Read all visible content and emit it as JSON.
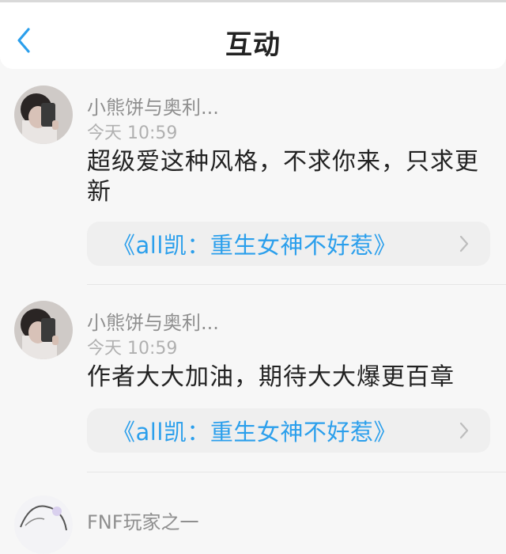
{
  "header": {
    "title": "互动",
    "back_icon": "chevron-left-icon",
    "accent_color": "#2b9fec"
  },
  "comments": [
    {
      "user": "小熊饼与奥利...",
      "time": "今天 10:59",
      "content": "超级爱这种风格，不求你来，只求更新",
      "book": "《all凯：重生女神不好惹》",
      "avatar_icon": "avatar-photo"
    },
    {
      "user": "小熊饼与奥利...",
      "time": "今天 10:59",
      "content": "作者大大加油，期待大大爆更百章",
      "book": "《all凯：重生女神不好惹》",
      "avatar_icon": "avatar-photo"
    },
    {
      "user": "FNF玩家之一",
      "avatar_icon": "avatar-anime"
    }
  ]
}
